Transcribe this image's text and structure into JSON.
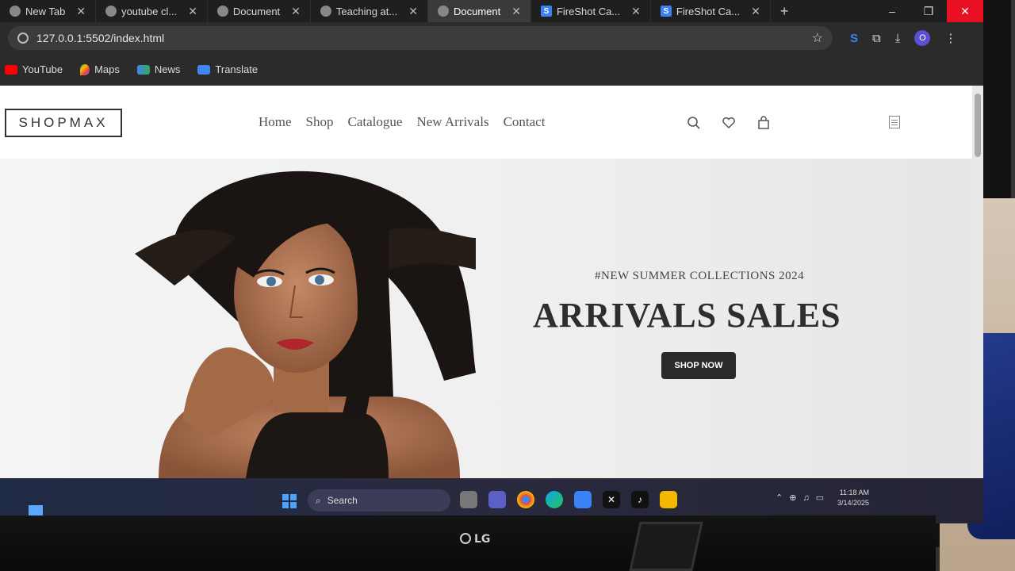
{
  "browser": {
    "tabs": [
      {
        "label": "New Tab",
        "favicon": "globe-icon"
      },
      {
        "label": "youtube cl...",
        "favicon": "globe-icon"
      },
      {
        "label": "Document",
        "favicon": "globe-icon"
      },
      {
        "label": "Teaching at...",
        "favicon": "globe-icon"
      },
      {
        "label": "Document",
        "favicon": "globe-icon",
        "active": true
      },
      {
        "label": "FireShot Ca...",
        "favicon": "fireshot-icon"
      },
      {
        "label": "FireShot Ca...",
        "favicon": "fireshot-icon"
      }
    ],
    "new_tab_symbol": "+",
    "url": "127.0.0.1:5502/index.html",
    "profile_initial": "O",
    "bookmarks": [
      {
        "label": "YouTube",
        "icon": "youtube-icon"
      },
      {
        "label": "Maps",
        "icon": "maps-icon"
      },
      {
        "label": "News",
        "icon": "news-icon"
      },
      {
        "label": "Translate",
        "icon": "translate-icon"
      }
    ]
  },
  "site": {
    "logo": "SHOPMAX",
    "nav": [
      "Home",
      "Shop",
      "Catalogue",
      "New Arrivals",
      "Contact"
    ],
    "hero": {
      "tag": "#NEW SUMMER COLLECTIONS 2024",
      "title": "ARRIVALS SALES",
      "cta": "SHOP NOW"
    }
  },
  "taskbar": {
    "search_placeholder": "Search",
    "time": "11:18 AM",
    "date": "3/14/2025"
  },
  "monitor": {
    "brand": "LG"
  },
  "colors": {
    "tab_bar": "#1f1f1f",
    "toolbar": "#2b2b2b",
    "cta_button": "#2a2a2a",
    "title_text": "#2e2e2e",
    "close_button": "#e81123"
  }
}
